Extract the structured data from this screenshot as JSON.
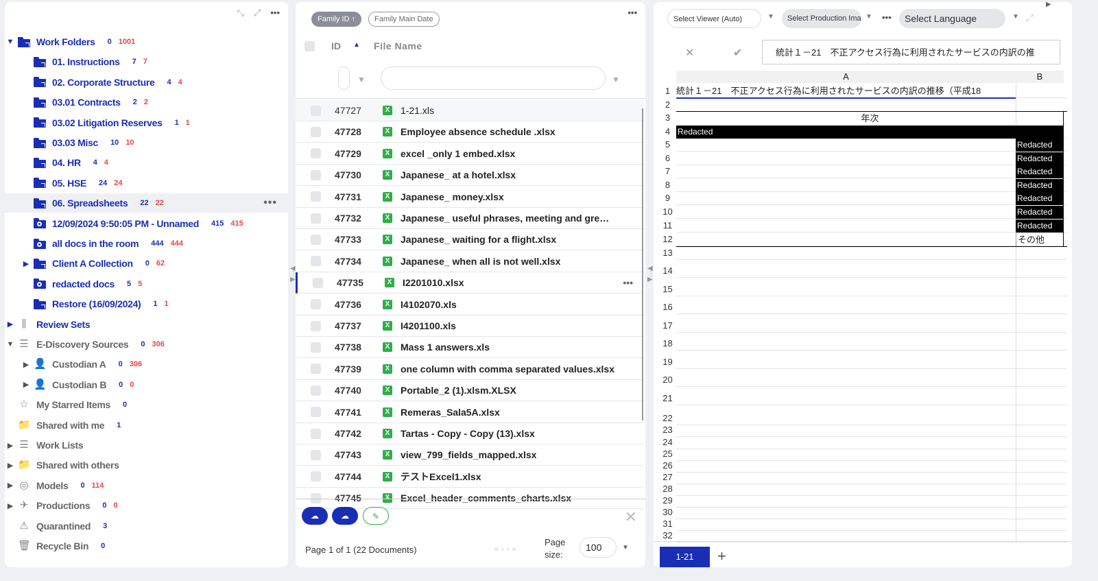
{
  "left_panel": {
    "tree": [
      {
        "label": "Work Folders",
        "c1": "0",
        "c2": "1001",
        "type": "folder",
        "arrow": "▼",
        "indent": 0
      },
      {
        "label": "01. Instructions",
        "c1": "7",
        "c2": "7",
        "type": "folder",
        "indent": 1
      },
      {
        "label": "02. Corporate Structure",
        "c1": "4",
        "c2": "4",
        "type": "folder",
        "indent": 1
      },
      {
        "label": "03.01 Contracts",
        "c1": "2",
        "c2": "2",
        "type": "folder",
        "indent": 1
      },
      {
        "label": "03.02 Litigation Reserves",
        "c1": "1",
        "c2": "1",
        "type": "folder",
        "indent": 1
      },
      {
        "label": "03.03 Misc",
        "c1": "10",
        "c2": "10",
        "type": "folder",
        "indent": 1
      },
      {
        "label": "04. HR",
        "c1": "4",
        "c2": "4",
        "type": "folder",
        "indent": 1
      },
      {
        "label": "05. HSE",
        "c1": "24",
        "c2": "24",
        "type": "folder",
        "indent": 1
      },
      {
        "label": "06. Spreadsheets",
        "c1": "22",
        "c2": "22",
        "type": "folder",
        "indent": 1,
        "selected": true
      },
      {
        "label": "12/09/2024 9:50:05 PM - Unnamed",
        "c1": "415",
        "c2": "415",
        "type": "search",
        "indent": 1
      },
      {
        "label": "all docs in the room",
        "c1": "444",
        "c2": "444",
        "type": "search",
        "indent": 1
      },
      {
        "label": "Client A Collection",
        "c1": "0",
        "c2": "62",
        "type": "folder",
        "indent": 1,
        "arrow": "▶"
      },
      {
        "label": "redacted docs",
        "c1": "5",
        "c2": "5",
        "type": "search",
        "indent": 1
      },
      {
        "label": "Restore (16/09/2024)",
        "c1": "1",
        "c2": "1",
        "type": "folder",
        "indent": 1
      },
      {
        "label": "Review Sets",
        "c1": "",
        "c2": "",
        "type": "reviewsets",
        "indent": 0,
        "arrow": "▶"
      },
      {
        "label": "E-Discovery Sources",
        "c1": "0",
        "c2": "306",
        "type": "db",
        "indent": 0,
        "arrow": "▼",
        "grey": true
      },
      {
        "label": "Custodian A",
        "c1": "0",
        "c2": "306",
        "type": "user",
        "indent": 1,
        "arrow": "▶",
        "grey": true
      },
      {
        "label": "Custodian B",
        "c1": "0",
        "c2": "0",
        "type": "user",
        "indent": 1,
        "arrow": "▶",
        "grey": true
      },
      {
        "label": "My Starred Items",
        "c1": "0",
        "c2": "",
        "type": "star",
        "indent": 0,
        "grey": true
      },
      {
        "label": "Shared with me",
        "c1": "1",
        "c2": "",
        "type": "shared",
        "indent": 0,
        "grey": true
      },
      {
        "label": "Work Lists",
        "c1": "",
        "c2": "",
        "type": "list",
        "indent": 0,
        "arrow": "▶",
        "grey": true
      },
      {
        "label": "Shared with others",
        "c1": "",
        "c2": "",
        "type": "shared",
        "indent": 0,
        "arrow": "▶",
        "grey": true
      },
      {
        "label": "Models",
        "c1": "0",
        "c2": "114",
        "type": "model",
        "indent": 0,
        "arrow": "▶",
        "grey": true
      },
      {
        "label": "Productions",
        "c1": "0",
        "c2": "0",
        "type": "prod",
        "indent": 0,
        "arrow": "▶",
        "grey": true
      },
      {
        "label": "Quarantined",
        "c1": "3",
        "c2": "",
        "type": "warn",
        "indent": 0,
        "grey": true
      },
      {
        "label": "Recycle Bin",
        "c1": "0",
        "c2": "",
        "type": "bin",
        "indent": 0,
        "grey": true
      }
    ]
  },
  "middle_panel": {
    "sort_pills": [
      "Family ID ↑",
      "Family Main Date"
    ],
    "col_id": "ID",
    "col_name": "File Name",
    "rows": [
      {
        "id": "47727",
        "name": "1-21.xls"
      },
      {
        "id": "47728",
        "name": "Employee absence schedule .xlsx"
      },
      {
        "id": "47729",
        "name": "excel _only 1 embed.xlsx"
      },
      {
        "id": "47730",
        "name": "Japanese_ at a hotel.xlsx"
      },
      {
        "id": "47731",
        "name": "Japanese_ money.xlsx"
      },
      {
        "id": "47732",
        "name": "Japanese_ useful phrases, meeting and gre…"
      },
      {
        "id": "47733",
        "name": "Japanese_ waiting for a flight.xlsx"
      },
      {
        "id": "47734",
        "name": "Japanese_ when all is not well.xlsx"
      },
      {
        "id": "47735",
        "name": "I2201010.xlsx"
      },
      {
        "id": "47736",
        "name": "I4102070.xls"
      },
      {
        "id": "47737",
        "name": "I4201100.xls"
      },
      {
        "id": "47738",
        "name": "Mass 1 answers.xls"
      },
      {
        "id": "47739",
        "name": "one column with comma separated values.xlsx"
      },
      {
        "id": "47740",
        "name": "Portable_2 (1).xlsm.XLSX"
      },
      {
        "id": "47741",
        "name": "Remeras_Sala5A.xlsx"
      },
      {
        "id": "47742",
        "name": "Tartas - Copy - Copy (13).xlsx"
      },
      {
        "id": "47743",
        "name": "view_799_fields_mapped.xlsx"
      },
      {
        "id": "47744",
        "name": "テストExcel1.xlsx"
      },
      {
        "id": "47745",
        "name": "Excel_header_comments_charts.xlsx"
      }
    ],
    "page_info": "Page 1 of 1 (22 Documents)",
    "page_size_label": "Page size:",
    "page_size": "100"
  },
  "right_panel": {
    "viewer": "Select Viewer (Auto)",
    "production": "Select Production Imag",
    "language": "Select Language",
    "formula": "統計１－21　不正アクセス行為に利用されたサービスの内訳の推",
    "col_a": "A",
    "col_b": "B",
    "a1": "統計１－21　不正アクセス行為に利用されたサービスの内訳の推移（平成18",
    "a3": "年次",
    "redacted": "Redacted",
    "b12": "その他",
    "rows": [
      "1",
      "2",
      "3",
      "4",
      "5",
      "6",
      "7",
      "8",
      "9",
      "10",
      "11",
      "12",
      "13",
      "14",
      "15",
      "16",
      "17",
      "18",
      "19",
      "20",
      "21",
      "22",
      "23",
      "24",
      "25",
      "26",
      "27",
      "28",
      "29",
      "30",
      "31",
      "32"
    ],
    "sheet_tab": "1-21",
    "add_tab": "+"
  }
}
